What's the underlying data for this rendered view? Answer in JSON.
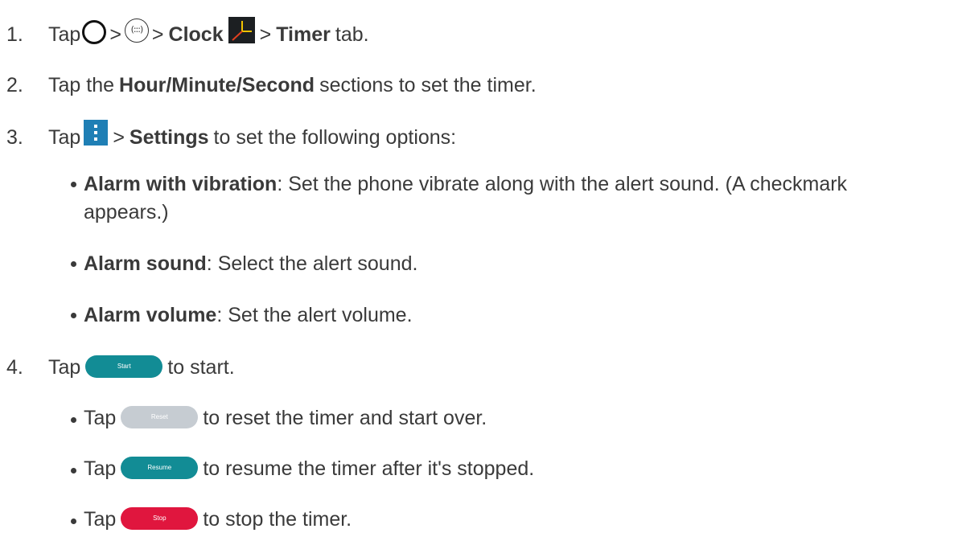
{
  "steps": [
    {
      "num": "1.",
      "tap": "Tap",
      "gt1": ">",
      "gt2": ">",
      "clock": "Clock",
      "gt3": ">",
      "timer": "Timer",
      "tail": "tab."
    },
    {
      "num": "2.",
      "pre": "Tap the",
      "bold": "Hour/Minute/Second",
      "tail": "sections to set the timer."
    },
    {
      "num": "3.",
      "tap": "Tap",
      "gt": ">",
      "bold": "Settings",
      "tail": "to set the following options:"
    },
    {
      "num": "4.",
      "tap": "Tap",
      "tail": "to start."
    }
  ],
  "options": [
    {
      "bold": "Alarm with vibration",
      "text": ": Set the phone vibrate along with the alert sound. (A checkmark",
      "text2": "appears.)"
    },
    {
      "bold": "Alarm sound",
      "text": ": Select the alert sound."
    },
    {
      "bold": "Alarm volume",
      "text": ": Set the alert volume."
    }
  ],
  "sub": [
    {
      "tap": "Tap",
      "tail": "to reset the timer and start over."
    },
    {
      "tap": "Tap",
      "tail": "to resume the timer after it's stopped."
    },
    {
      "tap": "Tap",
      "tail": "to stop the timer."
    }
  ],
  "buttons": {
    "start": "Start",
    "reset": "Reset",
    "resume": "Resume",
    "stop": "Stop"
  },
  "icons": {
    "apps": "(:::)",
    "home": "home-icon",
    "apps_name": "apps-icon",
    "clock": "clock-app-icon",
    "menu": "menu-icon"
  },
  "colors": {
    "start": "#128c95",
    "reset": "#c6ccd2",
    "resume": "#128c95",
    "stop": "#e0163e",
    "menu": "#1f7fb5"
  }
}
